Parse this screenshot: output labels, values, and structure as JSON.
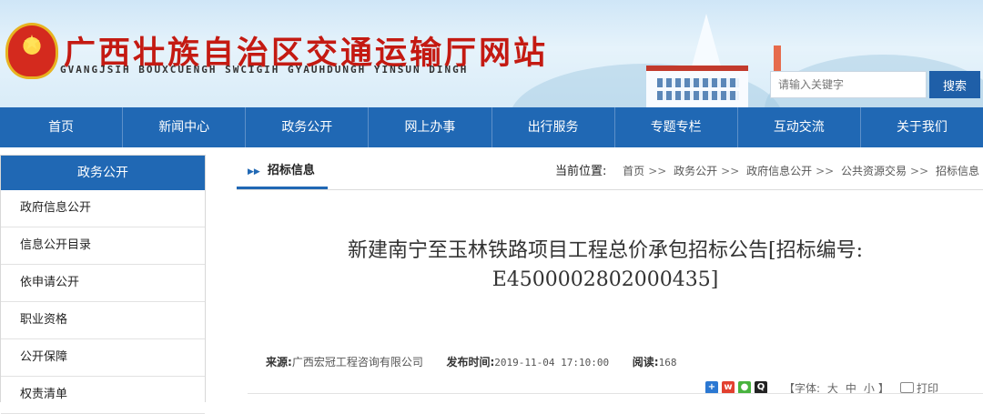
{
  "header": {
    "title": "广西壮族自治区交通运输厅网站",
    "subtitle": "GVANGJSIH BOUXCUENGH SWCIGIH GYAUHDUNGH YINSUN DINGH",
    "emblem_icon": "national-emblem-icon",
    "search": {
      "placeholder": "请输入关键字",
      "button_label": "搜索"
    }
  },
  "nav": {
    "items": [
      "首页",
      "新闻中心",
      "政务公开",
      "网上办事",
      "出行服务",
      "专题专栏",
      "互动交流",
      "关于我们"
    ]
  },
  "sidebar": {
    "title": "政务公开",
    "items": [
      "政府信息公开",
      "信息公开目录",
      "依申请公开",
      "职业资格",
      "公开保障",
      "权责清单"
    ]
  },
  "main": {
    "tab_label": "招标信息",
    "breadcrumb_label": "当前位置:",
    "breadcrumb": [
      "首页",
      "政务公开",
      "政府信息公开",
      "公共资源交易",
      "招标信息"
    ],
    "breadcrumb_separator": ">>",
    "article": {
      "title_line1": "新建南宁至玉林铁路项目工程总价承包招标公告[招标编号:",
      "title_line2": "E4500002802000435]",
      "source_label": "来源:",
      "source": "广西宏冠工程咨询有限公司",
      "published_label": "发布时间:",
      "published": "2019-11-04 17:10:00",
      "reads_label": "阅读:",
      "reads": "168"
    },
    "tools": {
      "share_icons": [
        "share-plus-icon",
        "weibo-icon",
        "wechat-icon",
        "qq-icon"
      ],
      "font_label_open": "【字体:",
      "font_large": "大",
      "font_medium": "中",
      "font_small": "小",
      "font_label_close": "】",
      "print_label": "打印"
    }
  },
  "colors": {
    "primary": "#2068b4",
    "title_red": "#c41a12"
  }
}
